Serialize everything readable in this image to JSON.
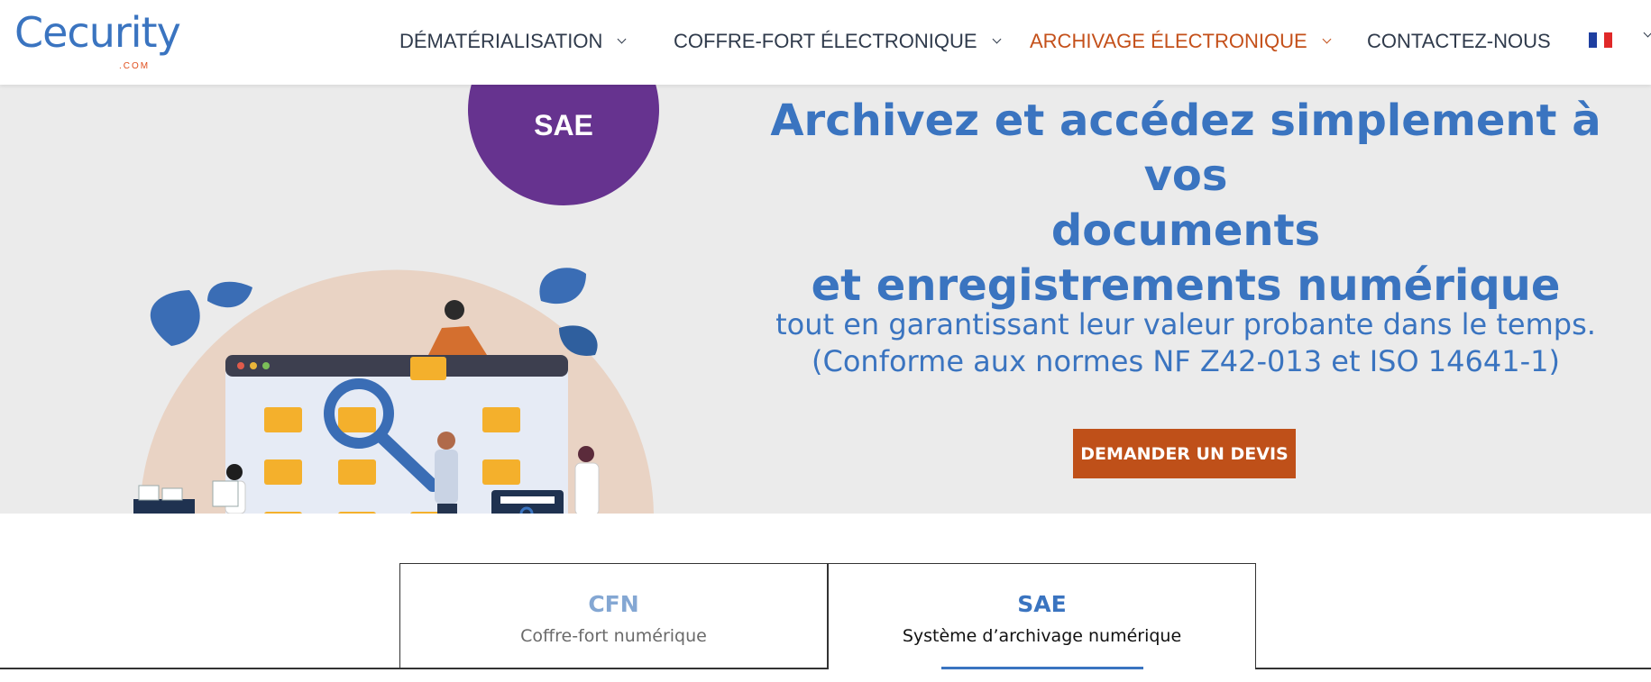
{
  "logo": {
    "text": "Cecurity",
    "sub": ".COM"
  },
  "nav": {
    "items": [
      {
        "label": "DÉMATÉRIALISATION",
        "has_dropdown": true,
        "active": false
      },
      {
        "label": "COFFRE-FORT ÉLECTRONIQUE",
        "has_dropdown": true,
        "active": false
      },
      {
        "label": "ARCHIVAGE ÉLECTRONIQUE",
        "has_dropdown": true,
        "active": true
      },
      {
        "label": "CONTACTEZ-NOUS",
        "has_dropdown": false,
        "active": false
      }
    ],
    "language_icon": "flag-france-icon"
  },
  "hero": {
    "badge": "SAE",
    "headline_line1": "Archivez et accédez simplement à vos",
    "headline_line2": "documents",
    "headline_line3": "et enregistrements numérique",
    "subline_line1": "tout en garantissant leur valeur probante dans le temps.",
    "subline_line2": "(Conforme aux normes NF Z42-013 et ISO 14641-1)",
    "cta_label": "DEMANDER UN DEVIS"
  },
  "tabs": [
    {
      "code": "CFN",
      "description": "Coffre-fort numérique",
      "selected": false
    },
    {
      "code": "SAE",
      "description": "Système d’archivage numérique",
      "selected": true
    }
  ],
  "colors": {
    "brand_blue": "#3a74c0",
    "accent_orange": "#bf5019",
    "badge_purple": "#66338f",
    "hero_bg": "#ebebeb"
  }
}
